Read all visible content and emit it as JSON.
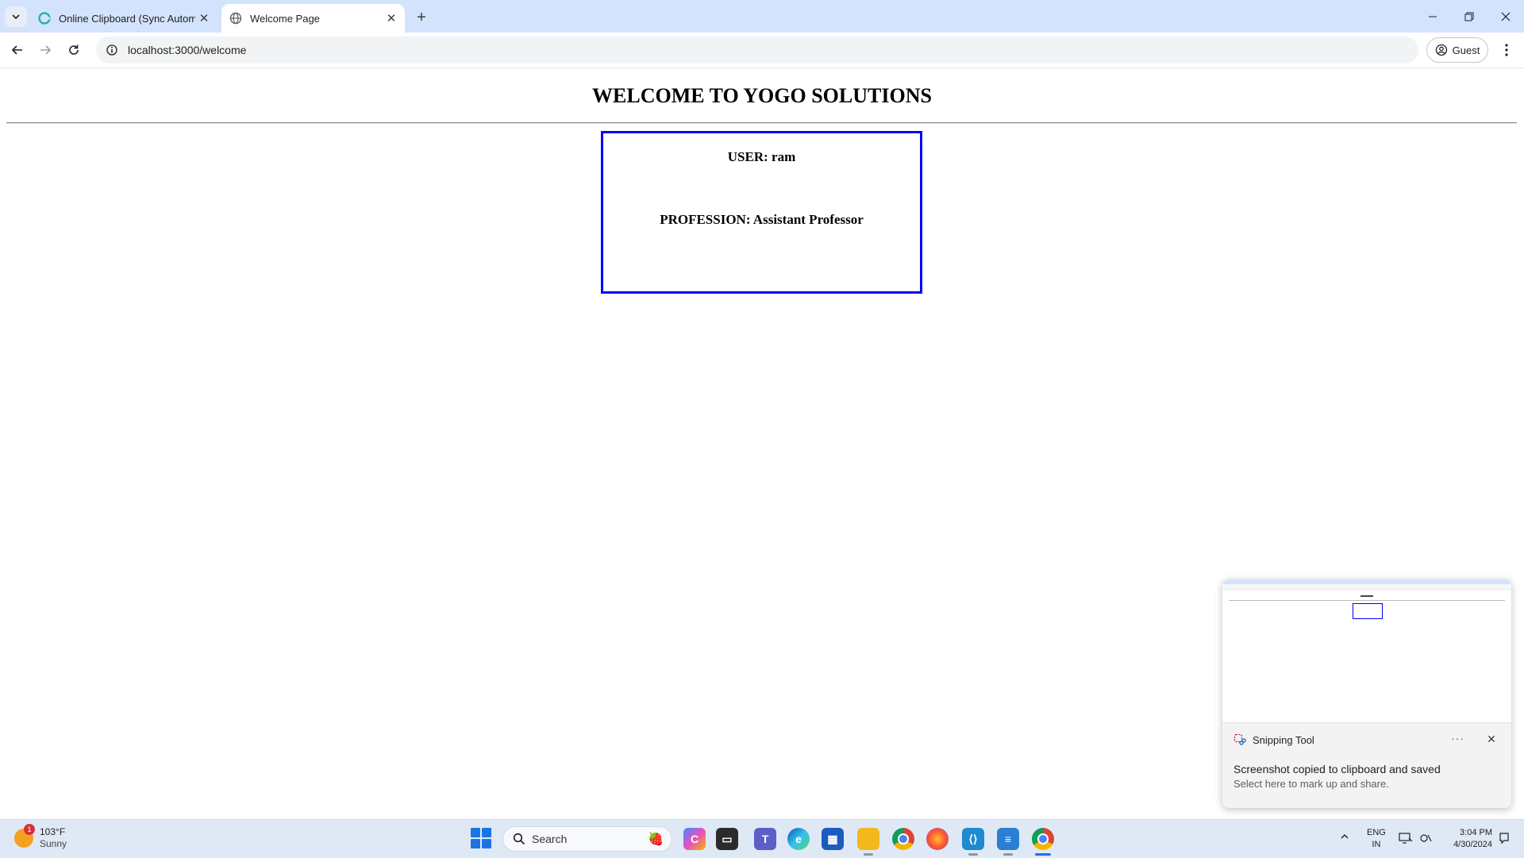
{
  "browser": {
    "tabs": [
      {
        "title": "Online Clipboard (Sync Automa",
        "active": false
      },
      {
        "title": "Welcome Page",
        "active": true
      }
    ],
    "url": "localhost:3000/welcome",
    "profile_label": "Guest"
  },
  "page": {
    "heading": "WELCOME TO YOGO SOLUTIONS",
    "user_line": "USER: ram",
    "profession_line": "PROFESSION: Assistant Professor",
    "card_border_color": "#0000ff"
  },
  "notification": {
    "app_name": "Snipping Tool",
    "message": "Screenshot copied to clipboard and saved",
    "sub_message": "Select here to mark up and share.",
    "more_label": "···"
  },
  "taskbar": {
    "weather_temp": "103°F",
    "weather_condition": "Sunny",
    "weather_badge": "1",
    "search_label": "Search",
    "lang_line1": "ENG",
    "lang_line2": "IN",
    "time": "3:04 PM",
    "date": "4/30/2024",
    "pinned_icons": [
      "copilot-icon",
      "file-explorer-dark-icon",
      "teams-icon",
      "edge-icon",
      "store-icon",
      "folder-icon",
      "chrome-icon",
      "firefox-icon",
      "vscode-icon",
      "notepad-icon",
      "chrome-active-icon"
    ]
  },
  "colors": {
    "tabstrip": "#d3e3fd",
    "taskbar": "#dfe9f5",
    "accent_blue": "#0000ff"
  }
}
